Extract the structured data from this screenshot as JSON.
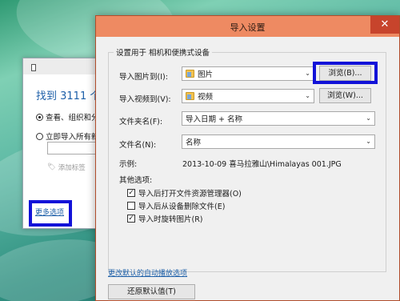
{
  "background_dialog": {
    "found_text": "找到 3111 个",
    "radio_1": "查看、组织和分",
    "radio_2": "立即导入所有新",
    "add_tag": "添加标签",
    "more_options": "更多选项"
  },
  "dialog": {
    "title": "导入设置",
    "close_label": "✕",
    "group_label": "设置用于 相机和便携式设备",
    "import_pictures_label": "导入图片到(I):",
    "import_pictures_value": "图片",
    "browse_pictures": "浏览(B)...",
    "import_videos_label": "导入视频到(V):",
    "import_videos_value": "视频",
    "browse_videos": "浏览(W)...",
    "folder_name_label": "文件夹名(F):",
    "folder_name_value": "导入日期 + 名称",
    "file_name_label": "文件名(N):",
    "file_name_value": "名称",
    "example_label": "示例:",
    "example_value": "2013-10-09 喜马拉雅山\\Himalayas 001.JPG",
    "other_options_label": "其他选项:",
    "options": [
      {
        "label": "导入后打开文件资源管理器(O)",
        "checked": true,
        "mark": "✓"
      },
      {
        "label": "导入后从设备删除文件(E)",
        "checked": false,
        "mark": ""
      },
      {
        "label": "导入时旋转图片(R)",
        "checked": true,
        "mark": "✓"
      }
    ],
    "autoplay_link": "更改默认的自动播放选项",
    "restore_defaults": "还原默认值(T)"
  },
  "colors": {
    "titlebar": "#ee8a62",
    "close_button": "#c7442c",
    "highlight": "#1212d8",
    "link": "#1d5fa8"
  }
}
